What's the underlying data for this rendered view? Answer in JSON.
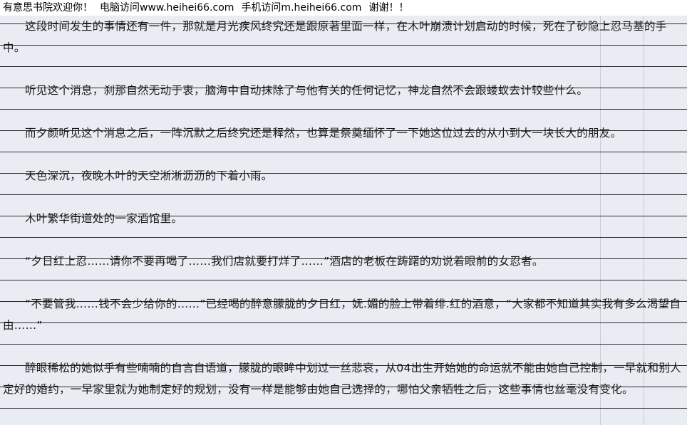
{
  "banner": {
    "site_name": "有意思书院欢迎你！",
    "pc_access": "电脑访问www.heihei66.com",
    "mobile_access": "手机访问m.heihei66.com",
    "thanks": "谢谢！！"
  },
  "paragraphs": [
    "这段时间发生的事情还有一件，那就是月光疾风终究还是跟原著里面一样，在木叶崩溃计划启动的时候，死在了砂隐上忍马基的手中。",
    "听见这个消息，刹那自然无动于衷，脑海中自动抹除了与他有关的任何记忆，神龙自然不会跟蝼蚁去计较些什么。",
    "而夕颜听见这个消息之后，一阵沉默之后终究还是释然，也算是祭奠缅怀了一下她这位过去的从小到大一块长大的朋友。",
    "天色深沉，夜晚木叶的天空淅淅沥沥的下着小雨。",
    "木叶繁华街道处的一家酒馆里。",
    "“夕日红上忍……请你不要再喝了……我们店就要打烊了……”酒店的老板在踌躇的劝说着眼前的女忍者。",
    "“不要管我……钱不会少给你的……”已经喝的醉意朦胧的夕日红，妩.媚的脸上带着绯.红的酒意，“大家都不知道其实我有多么渴望自由……”",
    "醉眼稀松的她似乎有些喃喃的自言自语道，朦胧的眼眸中划过一丝悲哀，从04出生开始她的命运就不能由她自己控制，一早就和别人定好的婚约，一早家里就为她制定好的规划，没有一样是能够由她自己选择的，哪怕父亲牺牲之后，这些事情也丝毫没有变化。"
  ]
}
